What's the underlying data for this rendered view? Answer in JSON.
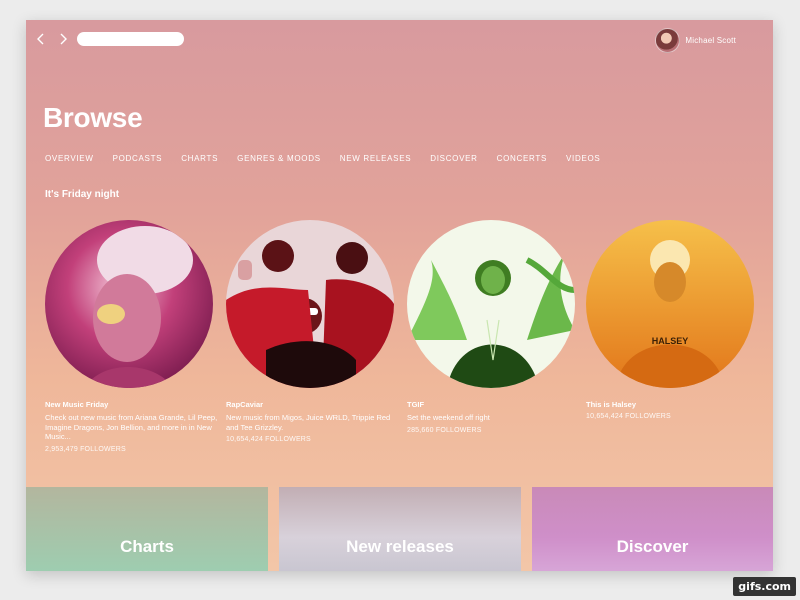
{
  "header": {
    "search_placeholder": "",
    "user_name": "Michael Scott"
  },
  "page": {
    "title": "Browse",
    "section_title": "It's Friday night"
  },
  "tabs": [
    {
      "label": "OVERVIEW"
    },
    {
      "label": "PODCASTS"
    },
    {
      "label": "CHARTS"
    },
    {
      "label": "GENRES & MOODS"
    },
    {
      "label": "NEW RELEASES"
    },
    {
      "label": "DISCOVER"
    },
    {
      "label": "CONCERTS"
    },
    {
      "label": "VIDEOS"
    }
  ],
  "playlists": [
    {
      "title": "New Music Friday",
      "description": "Check out new music from Ariana Grande, Lil Peep, Imagine Dragons, Jon Bellion, and more in in New Music...",
      "followers": "2,953,479 FOLLOWERS",
      "color": "#c2407a"
    },
    {
      "title": "RapCaviar",
      "description": "New music from Migos, Juice WRLD, Trippie Red and Tee Grizzley.",
      "followers": "10,654,424 FOLLOWERS",
      "color": "#c51a2a"
    },
    {
      "title": "TGIF",
      "description": "Set the weekend off right",
      "followers": "285,660 FOLLOWERS",
      "color": "#3aa03a"
    },
    {
      "title": "This is Halsey",
      "description": "",
      "followers": "10,654,424 FOLLOWERS",
      "color": "#e38a1c",
      "shirt_text": "HALSEY"
    }
  ],
  "tiles": [
    {
      "label": "Charts"
    },
    {
      "label": "New releases"
    },
    {
      "label": "Discover"
    }
  ],
  "watermark": "gifs.com"
}
